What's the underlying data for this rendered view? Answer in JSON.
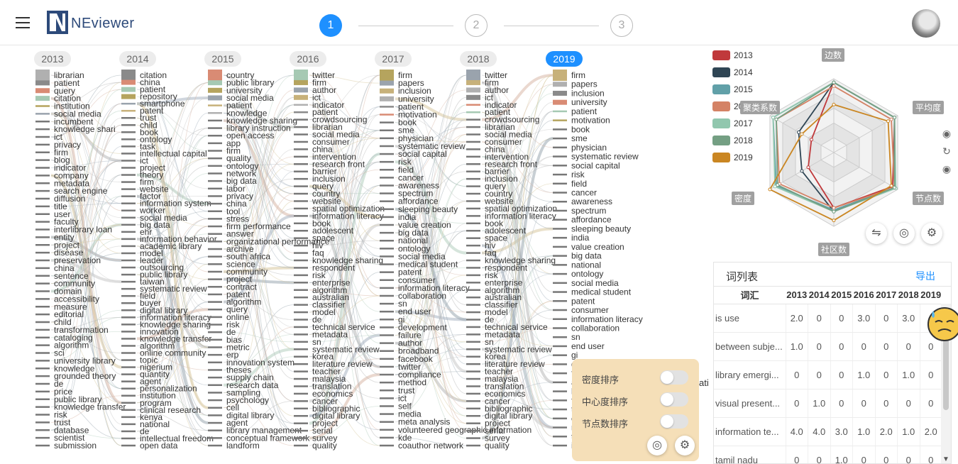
{
  "app": {
    "name": "NEviewer"
  },
  "steps": [
    "1",
    "2",
    "3"
  ],
  "years": [
    "2013",
    "2014",
    "2015",
    "2016",
    "2017",
    "2018",
    "2019"
  ],
  "active_year": "2019",
  "columns": [
    [
      "librarian",
      "patient",
      "query",
      "citation",
      "institution",
      "social media",
      "incumbent",
      "knowledge shari",
      "ict",
      "privacy",
      "firm",
      "blog",
      "indicator",
      "company",
      "metadata",
      "search engine",
      "diffusion",
      "title",
      "user",
      "faculty",
      "interlibrary loan",
      "entity",
      "project",
      "disease",
      "preservation",
      "china",
      "sentence",
      "community",
      "domain",
      "accessibility",
      "measure",
      "editorial",
      "child",
      "transformation",
      "cataloging",
      "algorithm",
      "sci",
      "university library",
      "knowledge",
      "grounded theory",
      "de",
      "price",
      "public library",
      "knowledge transfer",
      "risk",
      "trust",
      "database",
      "scientist",
      "submission"
    ],
    [
      "citation",
      "china",
      "patient",
      "repository",
      "smartphone",
      "patent",
      "trust",
      "child",
      "book",
      "ontology",
      "task",
      "intellectual capital",
      "ict",
      "project",
      "theory",
      "firm",
      "website",
      "factor",
      "information system",
      "worker",
      "social media",
      "big data",
      "ehr",
      "information behavior",
      "academic library",
      "model",
      "leader",
      "outsourcing",
      "public library",
      "taiwan",
      "systematic review",
      "field",
      "buyer",
      "digital library",
      "information literacy",
      "knowledge sharing",
      "innovation",
      "knowledge transfer",
      "algorithm",
      "online community",
      "topic",
      "nigerium",
      "quantity",
      "agent",
      "personalization",
      "institution",
      "program",
      "clinical research",
      "kenya",
      "national",
      "de",
      "intellectual freedom",
      "open data"
    ],
    [
      "country",
      "public library",
      "university",
      "social media",
      "patient",
      "knowledge",
      "knowledge sharing",
      "library instruction",
      "open access",
      "app",
      "firm",
      "quality",
      "ontology",
      "network",
      "big data",
      "labor",
      "privacy",
      "china",
      "tool",
      "stress",
      "firm performance",
      "answer",
      "organizational performance",
      "archive",
      "south africa",
      "science",
      "community",
      "project",
      "contract",
      "patent",
      "algorithm",
      "query",
      "online",
      "risk",
      "de",
      "bias",
      "metric",
      "erp",
      "innovation system",
      "theses",
      "supply chain",
      "research data",
      "sampling",
      "psychology",
      "cell",
      "digital library",
      "agent",
      "library management",
      "conceptual framework",
      "landform"
    ],
    [
      "twitter",
      "firm",
      "author",
      "ict",
      "indicator",
      "patient",
      "crowdsourcing",
      "librarian",
      "social media",
      "consumer",
      "china",
      "intervention",
      "research front",
      "barrier",
      "inclusion",
      "query",
      "country",
      "website",
      "spatial optimization",
      "information literacy",
      "book",
      "adolescent",
      "space",
      "hiv",
      "faq",
      "knowledge sharing",
      "respondent",
      "risk",
      "enterprise",
      "algorithm",
      "australian",
      "classifier",
      "model",
      "de",
      "technical service",
      "metadata",
      "sn",
      "systematic review",
      "korea",
      "literature review",
      "teacher",
      "malaysia",
      "translation",
      "economics",
      "cancer",
      "bibliographic",
      "digital library",
      "project",
      "serial",
      "survey",
      "quality"
    ],
    [
      "firm",
      "papers",
      "inclusion",
      "university",
      "patient",
      "motivation",
      "book",
      "sme",
      "physician",
      "systematic review",
      "social capital",
      "risk",
      "field",
      "cancer",
      "awareness",
      "spectrum",
      "affordance",
      "sleeping beauty",
      "india",
      "value creation",
      "big data",
      "national",
      "ontology",
      "social media",
      "medical student",
      "patent",
      "consumer",
      "information literacy",
      "collaboration",
      "sn",
      "end user",
      "gi",
      "development",
      "failure",
      "author",
      "broadband",
      "facebook",
      "twitter",
      "compliance",
      "method",
      "trust",
      "ict",
      "self",
      "media",
      "meta analysis",
      "volunteered geographic information",
      "kde",
      "coauthor network"
    ],
    [
      "twitter",
      "firm",
      "author",
      "ict",
      "indicator",
      "patient",
      "crowdsourcing",
      "librarian",
      "social media",
      "consumer",
      "china",
      "intervention",
      "research front",
      "barrier",
      "inclusion",
      "query",
      "country",
      "website",
      "spatial optimization",
      "information literacy",
      "book",
      "adolescent",
      "space",
      "hiv",
      "faq",
      "knowledge sharing",
      "respondent",
      "risk",
      "enterprise",
      "algorithm",
      "australian",
      "classifier",
      "model",
      "de",
      "technical service",
      "metadata",
      "sn",
      "systematic review",
      "korea",
      "literature review",
      "teacher",
      "malaysia",
      "translation",
      "economics",
      "cancer",
      "bibliographic",
      "digital library",
      "project",
      "serial",
      "survey",
      "quality"
    ],
    [
      "firm",
      "papers",
      "inclusion",
      "university",
      "patient",
      "motivation",
      "book",
      "sme",
      "physician",
      "systematic review",
      "social capital",
      "risk",
      "field",
      "cancer",
      "awareness",
      "spectrum",
      "affordance",
      "sleeping beauty",
      "india",
      "value creation",
      "big data",
      "national",
      "ontology",
      "social media",
      "medical student",
      "patent",
      "consumer",
      "information literacy",
      "collaboration",
      "sn",
      "end user",
      "gi",
      "development",
      "failure",
      "author",
      "broadband",
      "facebook",
      "twitter",
      "compliance",
      "method",
      "trust",
      "ict"
    ]
  ],
  "stray_text": "ati",
  "legend": [
    {
      "year": "2013",
      "color": "#c0393b"
    },
    {
      "year": "2014",
      "color": "#2f4554"
    },
    {
      "year": "2015",
      "color": "#61a0a8"
    },
    {
      "year": "2016",
      "color": "#d48265"
    },
    {
      "year": "2017",
      "color": "#91c7ae"
    },
    {
      "year": "2018",
      "color": "#749f83"
    },
    {
      "year": "2019",
      "color": "#ca8622"
    }
  ],
  "radar": {
    "labels": {
      "top": "边数",
      "top_right": "平均度",
      "bottom_right": "节点数",
      "bottom": "社区数",
      "bottom_left": "密度",
      "top_left": "聚类系数"
    },
    "axis_order": [
      "边数",
      "平均度",
      "节点数",
      "社区数",
      "密度",
      "聚类系数"
    ],
    "series": [
      {
        "year": "2013",
        "values": [
          0.95,
          0.95,
          0.92,
          0.75,
          0.4,
          0.35
        ]
      },
      {
        "year": "2014",
        "values": [
          0.95,
          0.95,
          0.95,
          0.8,
          0.5,
          0.55
        ]
      },
      {
        "year": "2015",
        "values": [
          0.95,
          0.95,
          0.95,
          0.78,
          0.9,
          0.95
        ]
      },
      {
        "year": "2016",
        "values": [
          0.9,
          0.9,
          0.95,
          0.75,
          0.85,
          0.9
        ]
      },
      {
        "year": "2017",
        "values": [
          0.95,
          0.95,
          0.97,
          0.8,
          0.92,
          0.95
        ]
      },
      {
        "year": "2018",
        "values": [
          0.95,
          0.95,
          0.95,
          0.8,
          0.88,
          0.9
        ]
      },
      {
        "year": "2019",
        "values": [
          0.65,
          0.85,
          0.9,
          0.92,
          1.0,
          0.5
        ]
      }
    ]
  },
  "wordlist": {
    "title": "词列表",
    "export_label": "导出",
    "headers": [
      "词汇",
      "2013",
      "2014",
      "2015",
      "2016",
      "2017",
      "2018",
      "2019"
    ],
    "rows": [
      {
        "word": "is use",
        "values": [
          "2.0",
          "0",
          "0",
          "3.0",
          "0",
          "3.0",
          ""
        ]
      },
      {
        "word": "between subje...",
        "values": [
          "1.0",
          "0",
          "0",
          "0",
          "0",
          "0",
          "0"
        ]
      },
      {
        "word": "library emergi...",
        "values": [
          "0",
          "0",
          "0",
          "1.0",
          "0",
          "1.0",
          "0"
        ]
      },
      {
        "word": "visual present...",
        "values": [
          "0",
          "1.0",
          "0",
          "0",
          "0",
          "0",
          "0"
        ]
      },
      {
        "word": "information te...",
        "values": [
          "4.0",
          "4.0",
          "3.0",
          "1.0",
          "2.0",
          "1.0",
          "2.0"
        ]
      },
      {
        "word": "tamil nadu",
        "values": [
          "0",
          "0",
          "1.0",
          "0",
          "0",
          "0",
          "0"
        ]
      }
    ]
  },
  "sort_panel": {
    "items": [
      "密度排序",
      "中心度排序",
      "节点数排序"
    ]
  }
}
